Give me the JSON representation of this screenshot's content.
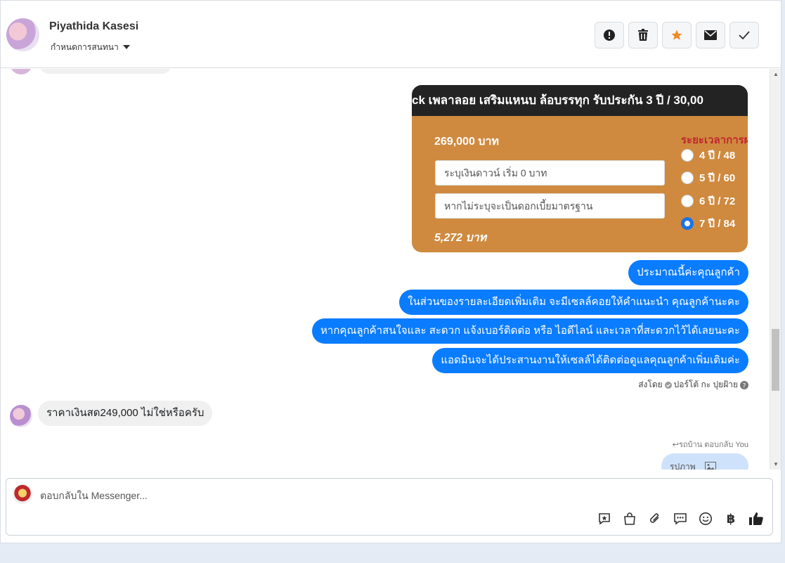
{
  "header": {
    "name": "Piyathida Kasesi",
    "status": "กำหนดการสนทนา",
    "actions": [
      "report-icon",
      "trash-icon",
      "star-icon",
      "envelope-icon",
      "check-icon"
    ],
    "star_color": "#f08a24"
  },
  "image_message": {
    "banner": "ck เพลาลอย เสริมแหนบ ล้อบรรทุก รับประกัน 3 ปี / 30,00",
    "price": "269,000 บาท",
    "down_payment_placeholder": "ระบุเงินดาวน์ เริ่ม 0 บาท",
    "interest_placeholder": "หากไม่ระบุจะเป็นดอกเบี้ยมาตรฐาน",
    "monthly": "5,272 บาท",
    "period_title": "ระยะเวลาการผ",
    "options": [
      {
        "label": "4 ปี / 48",
        "selected": false
      },
      {
        "label": "5 ปี / 60",
        "selected": false
      },
      {
        "label": "6 ปี / 72",
        "selected": false
      },
      {
        "label": "7 ปี / 84",
        "selected": true
      }
    ]
  },
  "outgoing": [
    "ประมาณนี้ค่ะคุณลูกค้า",
    "ในส่วนของรายละเอียดเพิ่มเติม จะมีเซลล์คอยให้คำแนะนำ คุณลูกค้านะคะ",
    "หากคุณลูกค้าสนใจและ สะดวก แจ้งเบอร์ติดต่อ หรือ ไอดีไลน์ และเวลาที่สะดวกไว้ได้เลยนะคะ",
    "แอดมินจะได้ประสานงานให้เซลล์ได้ติดต่อดูแลคุณลูกค้าเพิ่มเติมค่ะ"
  ],
  "sent_by": {
    "prefix": "ส่งโดย",
    "name": "ปอร์โต้ กะ ปุยฝ้าย"
  },
  "incoming": "ราคาเงินสด249,000 ไม่ใช่หรือครับ",
  "reply_note": "รถบ้าน ตอบกลับ You",
  "reply_preview": "รูปภาพ",
  "composer": {
    "placeholder": "ตอบกลับใน Messenger...",
    "tools": [
      "saved-reply-icon",
      "shop-icon",
      "attach-icon",
      "chat-icon",
      "emoji-icon",
      "baht-icon",
      "like-icon"
    ],
    "baht_symbol": "฿"
  },
  "colors": {
    "accent": "#0a7cff",
    "image_bg": "#cf8a3f"
  }
}
